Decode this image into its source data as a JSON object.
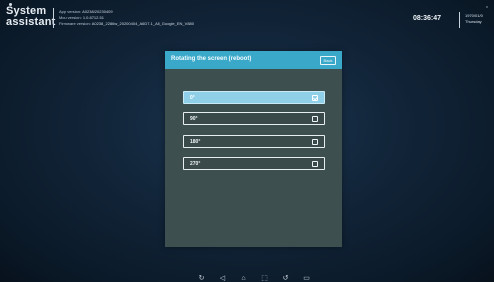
{
  "header": {
    "app_title": "System assistant",
    "versions": [
      {
        "key": "App version:",
        "value": "A0238/20230409"
      },
      {
        "key": "Mcu version:",
        "value": "1.0.8712.51"
      },
      {
        "key": "Firmware version:",
        "value": "A0238_2286w_20200404_A6D7.1_All_Google_EN_V880"
      }
    ],
    "time": "08:36:47",
    "date": "1970/01/0",
    "weekday": "Thursday",
    "close_glyph": "x"
  },
  "dialog": {
    "title": "Rotating the screen (reboot)",
    "back_label": "Back",
    "options": [
      {
        "label": "0°",
        "selected": true
      },
      {
        "label": "90°",
        "selected": false
      },
      {
        "label": "180°",
        "selected": false
      },
      {
        "label": "270°",
        "selected": false
      }
    ]
  },
  "nav_bar": {
    "icons": [
      "rotate-icon",
      "back-icon",
      "home-icon",
      "screenshot-icon",
      "refresh-icon",
      "recent-apps-icon"
    ],
    "glyphs": [
      "↻",
      "◁",
      "⌂",
      "⬚",
      "↺",
      "▭"
    ]
  },
  "colors": {
    "header_accent": "#3aa8c8",
    "dialog_body": "#3e4f4f",
    "selected_option": "#8fd0e8",
    "background": "#112438"
  }
}
